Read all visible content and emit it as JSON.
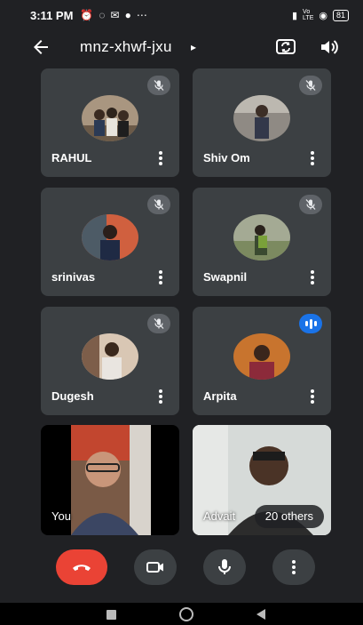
{
  "status_bar": {
    "time": "3:11 PM",
    "left_icons": [
      "alarm-icon",
      "message-icon",
      "mail-icon",
      "app-icon",
      "more-notifications-icon"
    ],
    "right_icons": [
      "signal-icon",
      "volte-icon",
      "wifi-icon"
    ],
    "battery": "81"
  },
  "header": {
    "meeting_code": "mnz-xhwf-jxu",
    "caret": "▸",
    "icons": [
      "back-arrow-icon",
      "switch-camera-icon",
      "speaker-icon"
    ]
  },
  "participants": [
    {
      "name": "RAHUL",
      "status": "muted"
    },
    {
      "name": "Shiv Om",
      "status": "muted"
    },
    {
      "name": "srinivas",
      "status": "muted"
    },
    {
      "name": "Swapnil",
      "status": "muted"
    },
    {
      "name": "Dugesh",
      "status": "muted"
    },
    {
      "name": "Arpita",
      "status": "speaking"
    }
  ],
  "video_tiles": {
    "self_label": "You",
    "other_label": "Advait",
    "others_count": "20 others"
  },
  "controls": {
    "icons": [
      "end-call-icon",
      "camera-icon",
      "mic-icon",
      "more-vert-icon"
    ],
    "end_call_color": "#ea4335"
  },
  "nav": {
    "icons": [
      "recent-apps-icon",
      "home-icon",
      "back-icon"
    ]
  },
  "colors": {
    "background": "#202124",
    "tile": "#3c4043",
    "accent_blue": "#1a73e8"
  }
}
